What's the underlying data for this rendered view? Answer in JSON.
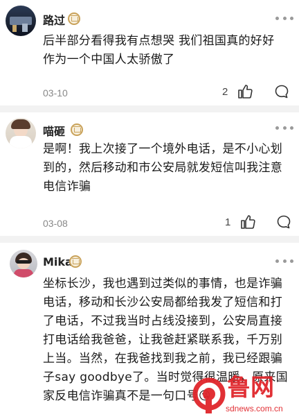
{
  "comments": [
    {
      "name": "路过",
      "text": "后半部分看得我有点想哭 我们祖国真的好好 作为一个中国人太骄傲了",
      "date": "03-10",
      "likes": "2"
    },
    {
      "name": "喵砸",
      "text": "是啊！我上次接了一个境外电话，是不小心划到的，然后移动和市公安局就发短信叫我注意电信诈骗",
      "date": "03-08",
      "likes": "1"
    },
    {
      "name": "Mika",
      "text": "坐标长沙，我也遇到过类似的事情，也是诈骗电话，移动和长沙公安局都给我发了短信和打了电话，不过我当时占线没接到，公安局直接打电话给我爸爸，让我爸赶紧联系我，千万别上当。当然，在我爸找到我之前，我已经跟骗子say goodbye了。当时觉得很温暖，原来国家反电信诈骗真不是一句口号😘"
    }
  ],
  "watermark": {
    "logo_text": "鲁网",
    "site": "sdnews.com.cn"
  },
  "colors": {
    "accent_red": "#e0252b",
    "vip_gold": "#c9a25a",
    "meta_gray": "#888888"
  }
}
